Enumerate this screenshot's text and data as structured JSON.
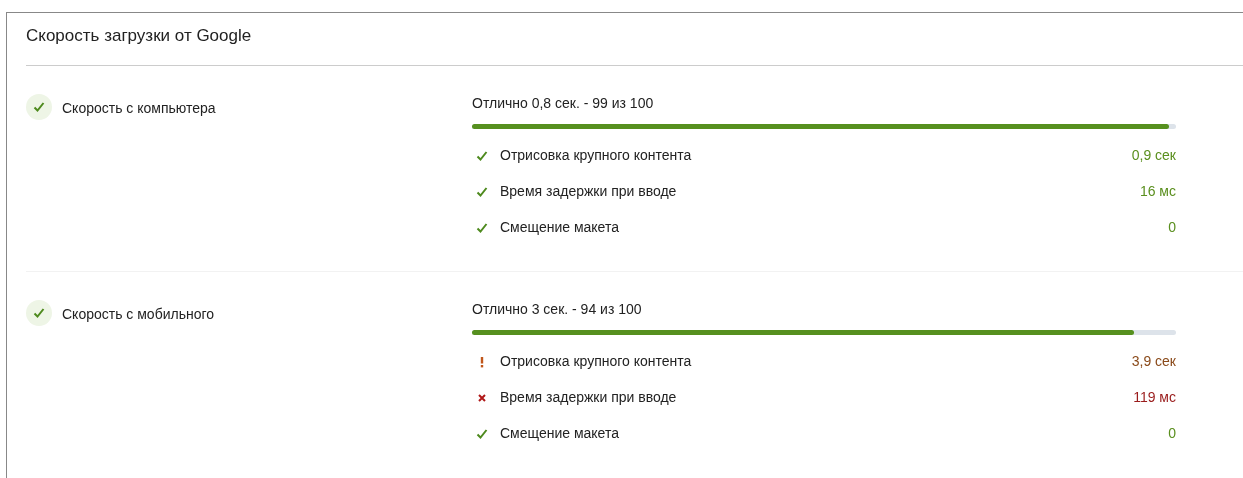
{
  "title": "Скорость загрузки от Google",
  "sections": [
    {
      "label": "Скорость с компьютера",
      "kind": "good",
      "summary": "Отлично 0,8 сек. - 99 из 100",
      "level": 0.99,
      "metrics": [
        {
          "name": "Отрисовка крупного контента",
          "value": "0,9 сек",
          "kind": "good"
        },
        {
          "name": "Время задержки при вводе",
          "value": "16 мс",
          "kind": "good"
        },
        {
          "name": "Смещение макета",
          "value": "0",
          "kind": "good"
        }
      ]
    },
    {
      "label": "Скорость с мобильного",
      "kind": "good",
      "summary": "Отлично 3 сек. - 94 из 100",
      "level": 0.94,
      "metrics": [
        {
          "name": "Отрисовка крупного контента",
          "value": "3,9 сек",
          "kind": "average"
        },
        {
          "name": "Время задержки при вводе",
          "value": "119 мс",
          "kind": "poor"
        },
        {
          "name": "Смещение макета",
          "value": "0",
          "kind": "good"
        }
      ]
    }
  ]
}
